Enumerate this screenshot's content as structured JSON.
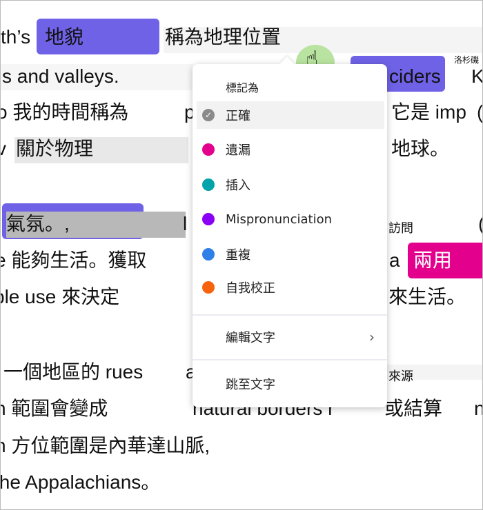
{
  "text_lines": [
    "th’s",
    "地貌",
    "稱為地理位置",
    "s and valleys.",
    "ciders",
    "洛杉磯",
    "K",
    "o 我的時間稱為",
    "p",
    "它是 imp",
    "(",
    "v",
    "關於物理",
    "地球。",
    "氣氛。,",
    "l",
    "訪問",
    "(",
    "e 能夠生活。獲取",
    "a",
    "兩用",
    "ble use 來決定",
    "來生活。",
    "一個地區的 rues",
    "a",
    "來源",
    "n 範圍會變成",
    "natural borders r",
    "或結算",
    "n",
    "n 方位範圍是內華達山脈,",
    "the Appalachians。"
  ],
  "context_menu": {
    "header": "標記為",
    "items": [
      {
        "label": "正確",
        "color": "#8a8a8a",
        "icon": "check-icon",
        "selected": true
      },
      {
        "label": "遺漏",
        "color": "#e3008c"
      },
      {
        "label": "插入",
        "color": "#00a3a9"
      },
      {
        "label": "Mispronunciation",
        "color": "#8a00f5"
      },
      {
        "label": "重複",
        "color": "#2f7fe8"
      },
      {
        "label": "自我校正",
        "color": "#f7630c"
      }
    ],
    "edit_text": "編輯文字",
    "jump_to_text": "跳至文字"
  },
  "colors": {
    "highlight_purple": "#6f62e6",
    "highlight_magenta": "#e3008c",
    "cursor_halo": "#b9e3a0"
  }
}
